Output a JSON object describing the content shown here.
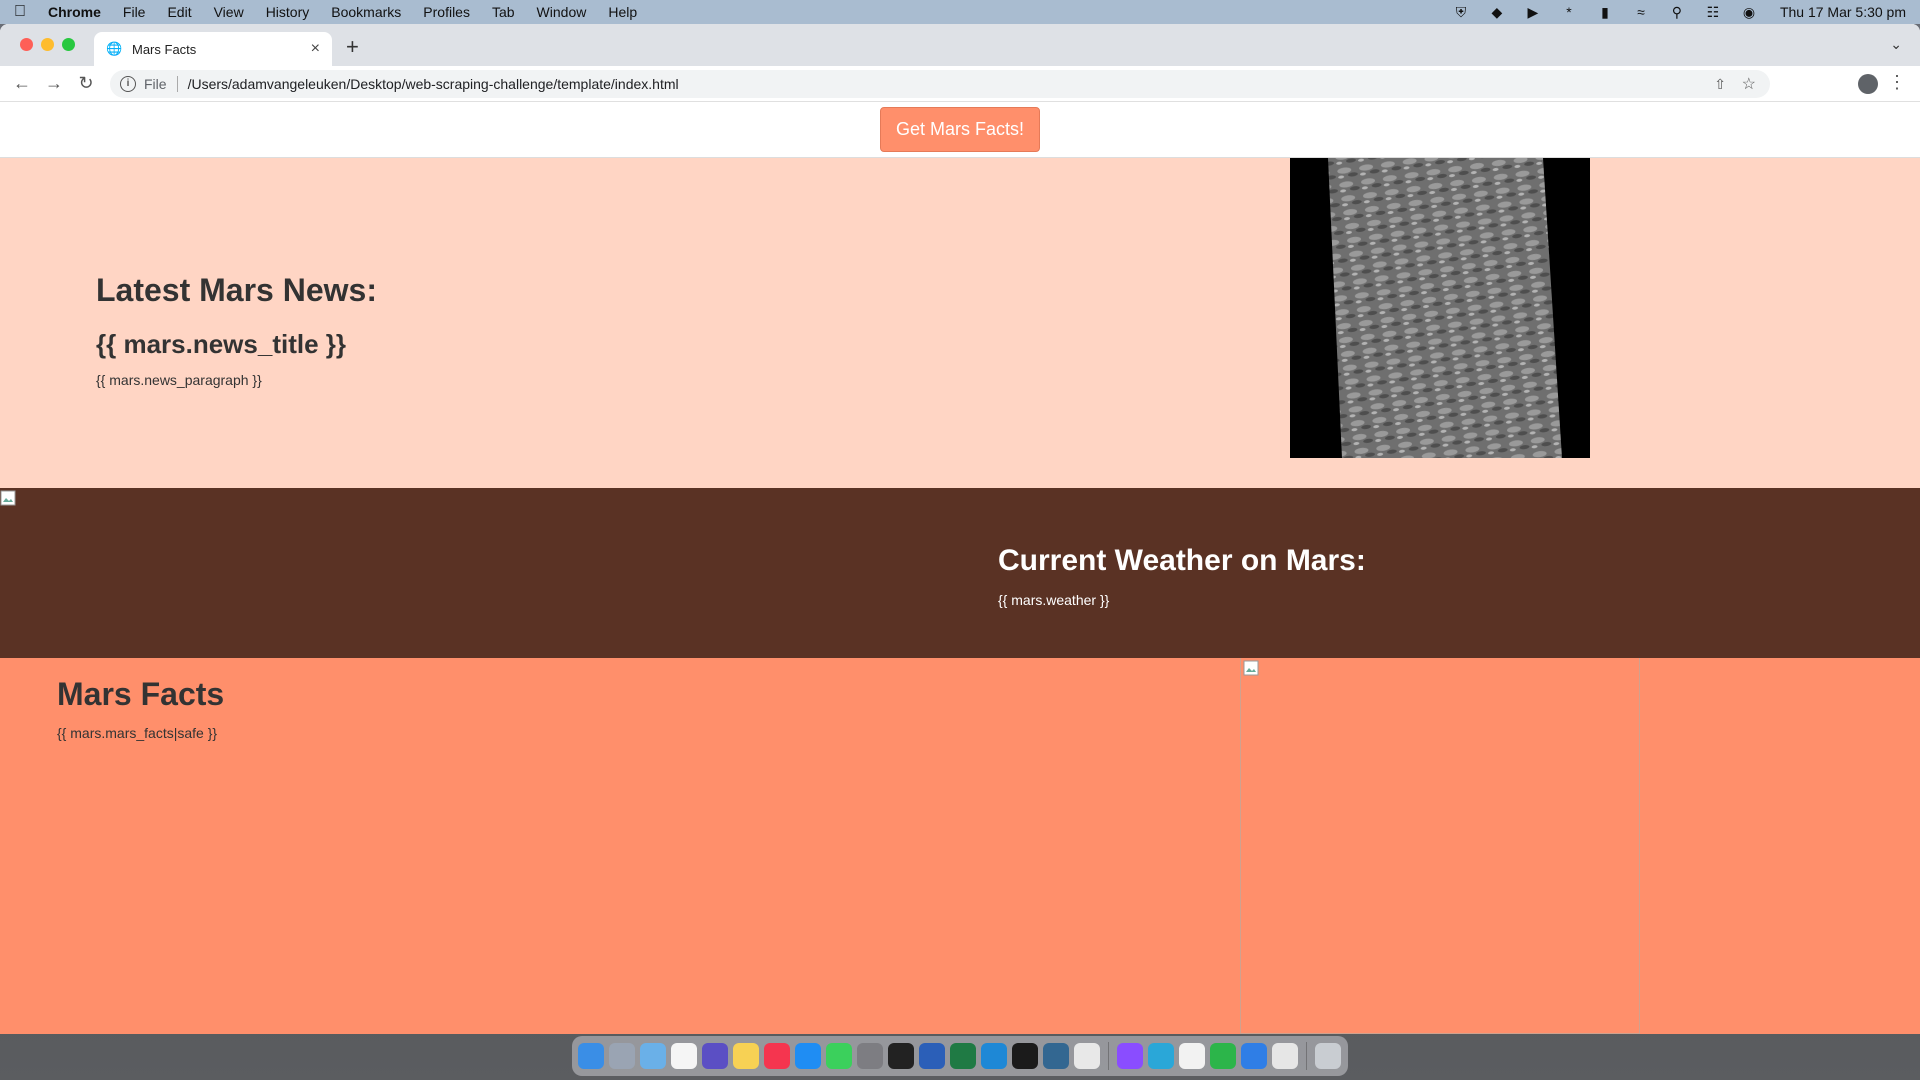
{
  "menubar": {
    "app_name": "Chrome",
    "items": [
      "File",
      "Edit",
      "View",
      "History",
      "Bookmarks",
      "Profiles",
      "Tab",
      "Window",
      "Help"
    ],
    "clock": "Thu 17 Mar  5:30 pm"
  },
  "browser": {
    "tab_title": "Mars Facts",
    "url_scheme": "File",
    "url": "/Users/adamvangeleuken/Desktop/web-scraping-challenge/template/index.html"
  },
  "page": {
    "scrape_button_label": "Get Mars Facts!",
    "news": {
      "heading": "Latest Mars News:",
      "title": "{{ mars.news_title }}",
      "paragraph": "{{ mars.news_paragraph }}"
    },
    "weather": {
      "heading": "Current Weather on Mars:",
      "value": "{{ mars.weather }}"
    },
    "facts": {
      "heading": "Mars Facts",
      "value": "{{ mars.mars_facts|safe }}"
    }
  },
  "colors": {
    "button": "#ff8f6b",
    "news_bg": "#ffd5c4",
    "weather_bg": "#5a3224",
    "facts_bg": "#ff8f6b"
  },
  "dock": {
    "icons": [
      "finder-icon",
      "launchpad-icon",
      "preview-icon",
      "calendar-icon",
      "linear-icon",
      "notes-icon",
      "music-icon",
      "app-store-icon",
      "messages-icon",
      "system-preferences-icon",
      "live-icon",
      "word-icon",
      "excel-icon",
      "vscode-icon",
      "terminal-icon",
      "pgadmin-icon",
      "chrome-icon",
      "messenger-icon",
      "edge-icon",
      "slack-icon",
      "numbers-icon",
      "safari-icon",
      "chrome-canary-icon",
      "trash-icon"
    ]
  }
}
